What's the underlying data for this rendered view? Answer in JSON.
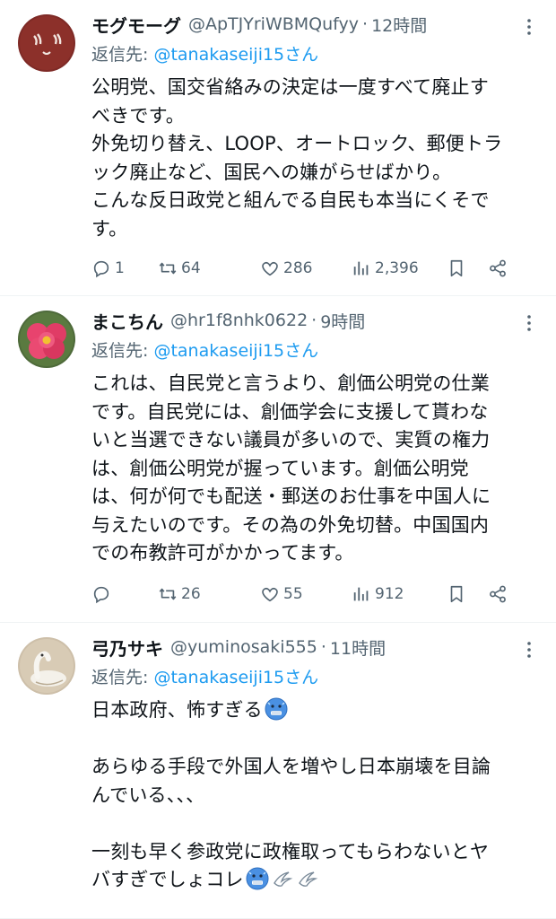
{
  "tweets": [
    {
      "name": "モグモーグ",
      "handle": "@ApTJYriWBMQufyy",
      "sep": "·",
      "time": "12時間",
      "reply_prefix": "返信先: ",
      "reply_mention": "@tanakaseiji15さん",
      "lines": [
        "公明党、国交省絡みの決定は一度すべて廃止す",
        "べきです。",
        "外免切り替え、LOOP、オートロック、郵便トラ",
        "ック廃止など、国民への嫌がらせばかり。",
        "こんな反日政党と組んでる自民も本当にくそで",
        "す。"
      ],
      "replies": "1",
      "retweets": "64",
      "likes": "286",
      "views": "2,396"
    },
    {
      "name": "まこちん",
      "handle": "@hr1f8nhk0622",
      "sep": "·",
      "time": "9時間",
      "reply_prefix": "返信先: ",
      "reply_mention": "@tanakaseiji15さん",
      "lines": [
        "これは、自民党と言うより、創価公明党の仕業",
        "です。自民党には、創価学会に支援して貰わな",
        "いと当選できない議員が多いので、実質の権力",
        "は、創価公明党が握っています。創価公明党",
        "は、何が何でも配送・郵送のお仕事を中国人に",
        "与えたいのです。その為の外免切替。中国国内",
        "での布教許可がかかってます。"
      ],
      "replies": "",
      "retweets": "26",
      "likes": "55",
      "views": "912"
    },
    {
      "name": "弓乃サキ",
      "handle": "@yuminosaki555",
      "sep": "·",
      "time": "11時間",
      "reply_prefix": "返信先: ",
      "reply_mention": "@tanakaseiji15さん",
      "lines": [
        "日本政府、怖すぎる",
        "",
        "あらゆる手段で外国人を増やし日本崩壊を目論",
        "んでいる、、、",
        "",
        "一刻も早く参政党に政権取ってもらわないとヤ",
        "バすぎでしょコレ"
      ]
    }
  ],
  "colors": {
    "accent": "#1d9bf0",
    "muted": "#536471",
    "text": "#0f1419"
  },
  "icons": [
    "reply-icon",
    "retweet-icon",
    "heart-icon",
    "views-icon",
    "bookmark-icon",
    "share-icon",
    "more-icon",
    "cold-face-emoji",
    "dash-emoji"
  ]
}
